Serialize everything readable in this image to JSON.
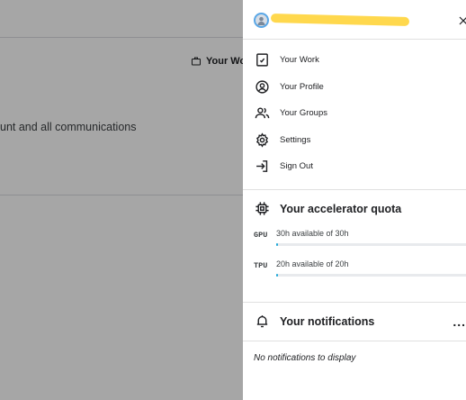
{
  "background": {
    "your_work_label": "Your Wo",
    "text_fragment": "unt and all communications"
  },
  "drawer": {
    "user_name": "",
    "menu": [
      {
        "label": "Your Work",
        "icon": "clipboard-icon"
      },
      {
        "label": "Your Profile",
        "icon": "profile-circle-icon"
      },
      {
        "label": "Your Groups",
        "icon": "groups-icon"
      },
      {
        "label": "Settings",
        "icon": "gear-icon"
      },
      {
        "label": "Sign Out",
        "icon": "sign-out-icon"
      }
    ],
    "quota": {
      "title": "Your accelerator quota",
      "items": [
        {
          "label": "GPU",
          "text": "30h available of 30h",
          "fraction": 0.01
        },
        {
          "label": "TPU",
          "text": "20h available of 20h",
          "fraction": 0.01
        }
      ]
    },
    "notifications": {
      "title": "Your notifications",
      "more": "...",
      "empty": "No notifications to display"
    }
  },
  "colors": {
    "accent": "#20a8d8",
    "redaction": "#ffd84d"
  }
}
